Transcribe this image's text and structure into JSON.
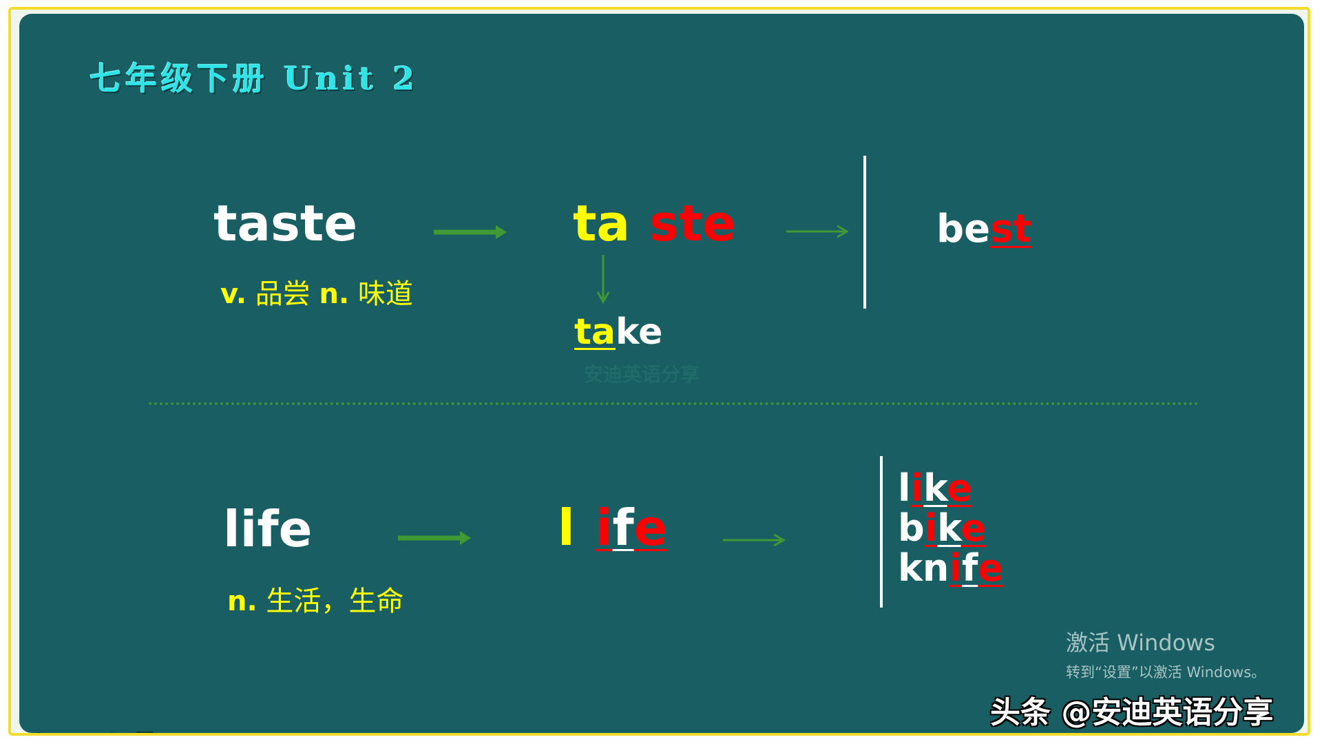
{
  "slide_title": "七年级下册 Unit 2",
  "row1": {
    "word": "taste",
    "meaning_pos1": "v.",
    "meaning_text1": " 品尝 ",
    "meaning_pos2": "n.",
    "meaning_text2": " 味道",
    "split_part1": "ta",
    "split_part2": "ste",
    "derived_prefix": "ta",
    "derived_rest": "ke",
    "compare_prefix": "be",
    "compare_suffix": "st"
  },
  "row2": {
    "word": "life",
    "meaning_pos": "n.",
    "meaning_text": " 生活，生命",
    "split_l": "l",
    "split_i": "i",
    "split_f": "f",
    "split_e": "e",
    "examples": [
      {
        "a": "l",
        "b": "i",
        "c": "k",
        "d": "e"
      },
      {
        "a": "b",
        "b": "i",
        "c": "k",
        "d": "e"
      },
      {
        "a": "kn",
        "b": "i",
        "c": "f",
        "d": "e"
      }
    ]
  },
  "watermark_center": "安迪英语分享",
  "activate_line1": "激活 Windows",
  "activate_line2": "转到“设置”以激活 Windows。",
  "credit": "头条 @安迪英语分享",
  "colors": {
    "board": "#185e62",
    "border": "#f4dc2c",
    "yellow": "#ffff00",
    "red": "#ff0000",
    "arrow": "#3f9a34"
  },
  "toolbar_icons": [
    "pen-icon",
    "squiggle-icon",
    "highlighter-icon",
    "eraser-icon",
    "pointer-icon",
    "circle-icon"
  ]
}
